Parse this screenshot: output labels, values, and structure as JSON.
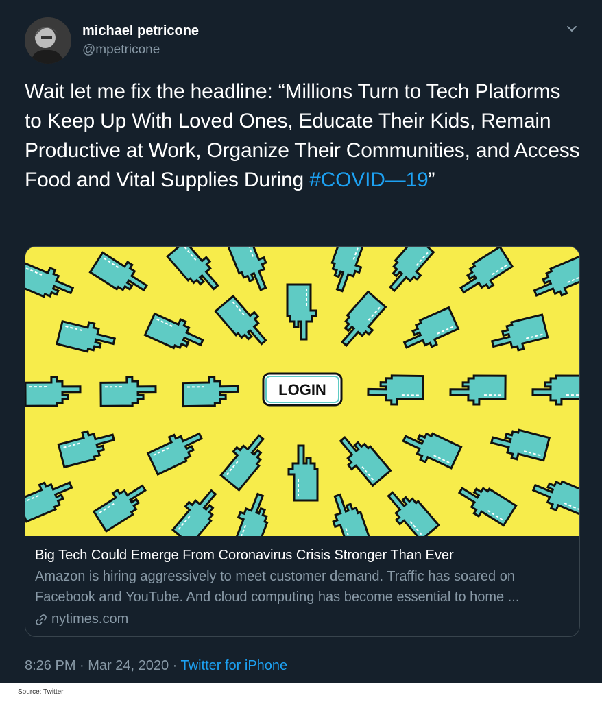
{
  "tweet": {
    "author": {
      "display_name": "michael petricone",
      "handle": "@mpetricone"
    },
    "text_before_hashtag": "Wait let me fix the headline:  “Millions Turn to Tech Platforms to Keep Up With Loved Ones, Educate Their Kids, Remain Productive at Work, Organize Their Communities, and Access Food and Vital Supplies During ",
    "hashtag": "#COVID—19",
    "text_after_hashtag": "”",
    "card": {
      "image_button_text": "LOGIN",
      "title": "Big Tech Could Emerge From Coronavirus Crisis Stronger Than Ever",
      "description": "Amazon is hiring aggressively to meet customer demand. Traffic has soared on Facebook and YouTube. And cloud computing has become essential to home ...",
      "domain": "nytimes.com"
    },
    "time": "8:26 PM",
    "separator": " · ",
    "date": "Mar 24, 2020",
    "source": "Twitter for iPhone",
    "more_icon": "chevron-down-icon",
    "link_icon": "link-icon"
  },
  "footer": {
    "credit": "Source: Twitter"
  },
  "colors": {
    "background": "#15202b",
    "accent": "#1da1f2",
    "secondary_text": "#8899a6",
    "card_border": "#38444d",
    "image_yellow": "#f7ec4b",
    "hand_teal": "#5fcbc4"
  }
}
